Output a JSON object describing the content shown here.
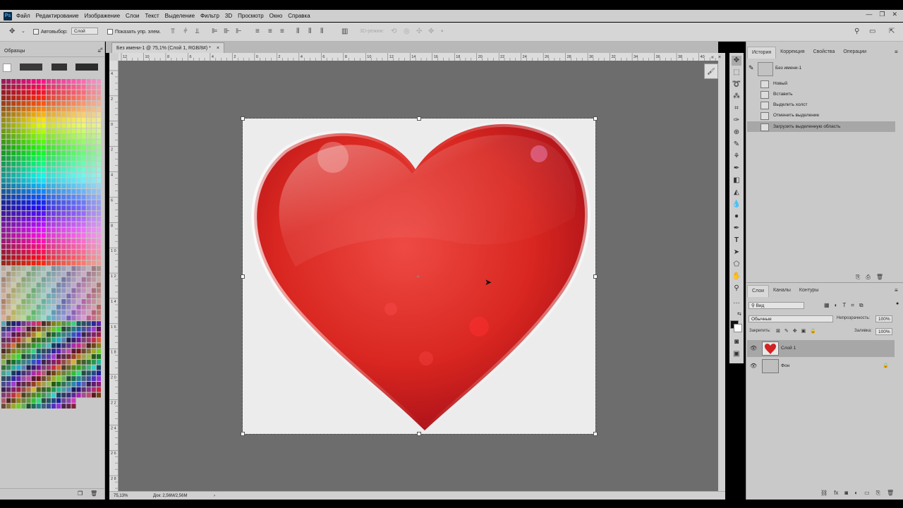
{
  "app": {
    "logo": "Ps"
  },
  "menu": [
    "Файл",
    "Редактирование",
    "Изображение",
    "Слои",
    "Текст",
    "Выделение",
    "Фильтр",
    "3D",
    "Просмотр",
    "Окно",
    "Справка"
  ],
  "options": {
    "autoselect_label": "Автовыбор:",
    "autoselect_value": "Слой",
    "show_controls_label": "Показать упр. элем.",
    "mode3d_label": "3D-режим:"
  },
  "left_panel": {
    "title": "Образцы"
  },
  "document": {
    "tab_title": "Без имени-1 @ 75,1% (Слой 1, RGB/8#) *",
    "zoom": "75,13%",
    "doc_info": "Док: 2,56M/2,56M",
    "ruler_h": [
      "12",
      "10",
      "8",
      "6",
      "4",
      "2",
      "0",
      "2",
      "4",
      "6",
      "8",
      "10",
      "12",
      "14",
      "16",
      "18",
      "20",
      "22",
      "24",
      "26",
      "28",
      "30",
      "32",
      "34",
      "36",
      "38",
      "40"
    ],
    "ruler_v": [
      "4",
      "2",
      "0",
      "2",
      "4",
      "6",
      "8",
      "1 0",
      "1 2",
      "1 4",
      "1 6",
      "1 8",
      "2 0",
      "2 2",
      "2 4",
      "2 6",
      "2 8"
    ]
  },
  "history": {
    "tabs": [
      "История",
      "Коррекция",
      "Свойства",
      "Операции"
    ],
    "snapshot": "Без имени-1",
    "items": [
      "Новый",
      "Вставить",
      "Выделить холст",
      "Отменить выделение",
      "Загрузить выделенную область"
    ],
    "active_index": 4
  },
  "layers": {
    "tabs": [
      "Слои",
      "Каналы",
      "Контуры"
    ],
    "filter": "Вид",
    "blend_mode": "Обычные",
    "opacity_label": "Непрозрачность:",
    "opacity": "100%",
    "lock_label": "Закрепить:",
    "fill_label": "Заливка:",
    "fill": "100%",
    "items": [
      {
        "name": "Слой 1",
        "selected": true
      },
      {
        "name": "Фон",
        "locked": true
      }
    ]
  },
  "colors": {
    "accent": "#31a8ff",
    "foreground": "#111111",
    "background": "#ffffff",
    "selected_row": "#a7a7a7"
  }
}
